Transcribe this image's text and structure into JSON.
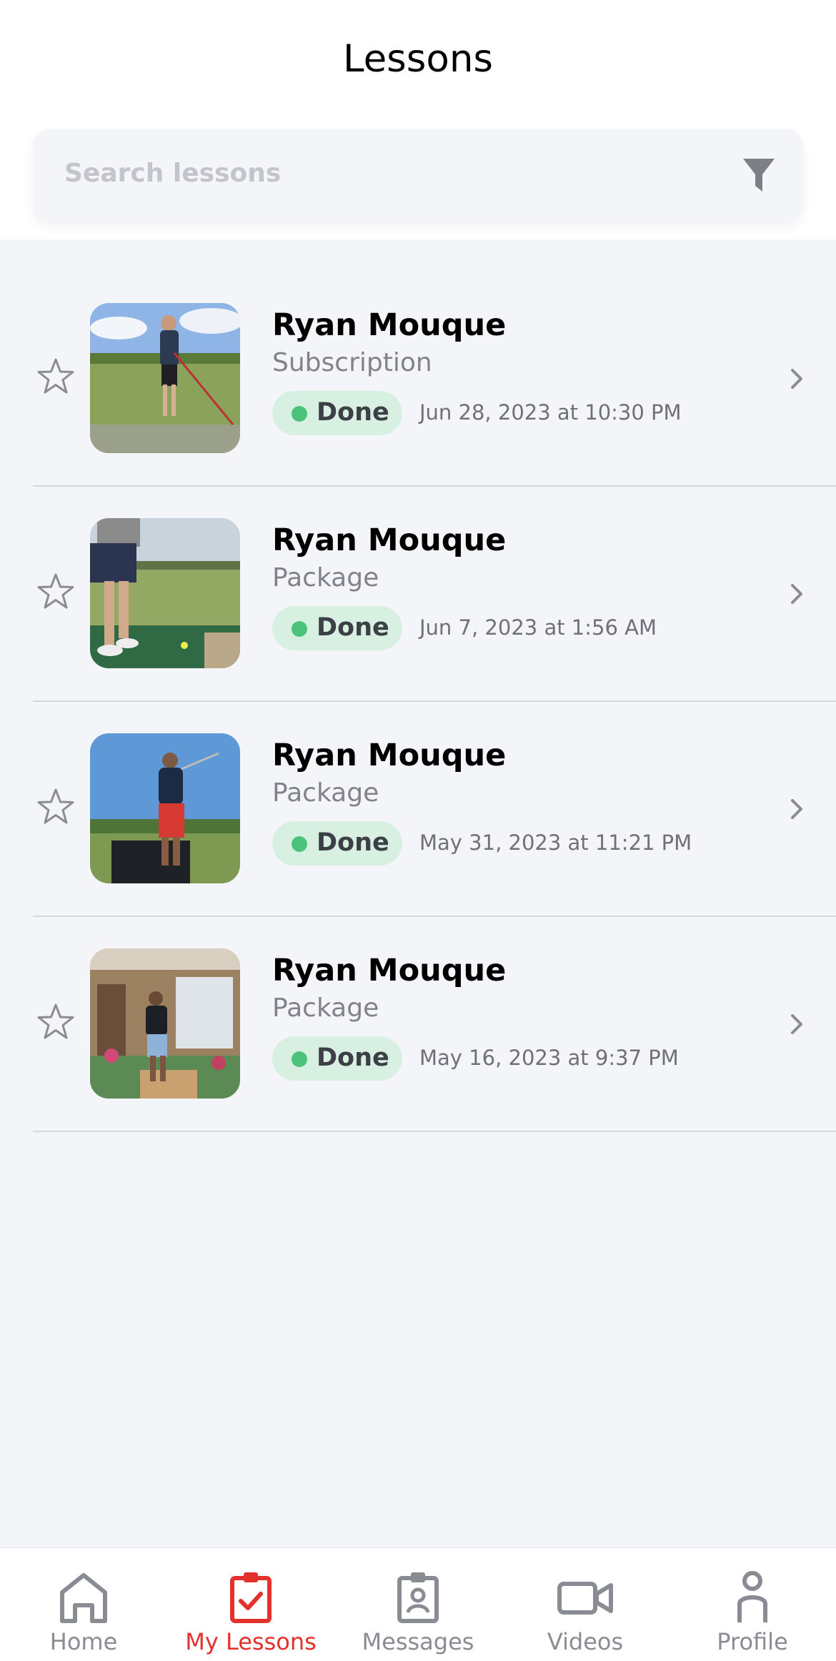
{
  "header": {
    "title": "Lessons"
  },
  "search": {
    "placeholder": "Search lessons",
    "filter_icon": "filter-icon"
  },
  "lessons": [
    {
      "coach": "Ryan Mouque",
      "type": "Subscription",
      "status": "Done",
      "date": "Jun 28, 2023 at 10:30 PM",
      "favorite": false
    },
    {
      "coach": "Ryan Mouque",
      "type": "Package",
      "status": "Done",
      "date": "Jun 7, 2023 at 1:56 AM",
      "favorite": false
    },
    {
      "coach": "Ryan Mouque",
      "type": "Package",
      "status": "Done",
      "date": "May 31, 2023 at 11:21 PM",
      "favorite": false
    },
    {
      "coach": "Ryan Mouque",
      "type": "Package",
      "status": "Done",
      "date": "May 16, 2023 at 9:37 PM",
      "favorite": false
    }
  ],
  "nav": {
    "items": [
      {
        "label": "Home",
        "icon": "home-icon",
        "active": false
      },
      {
        "label": "My Lessons",
        "icon": "clipboard-check-icon",
        "active": true
      },
      {
        "label": "Messages",
        "icon": "contact-badge-icon",
        "active": false
      },
      {
        "label": "Videos",
        "icon": "video-camera-icon",
        "active": false
      },
      {
        "label": "Profile",
        "icon": "person-icon",
        "active": false
      }
    ]
  },
  "colors": {
    "accent": "#e3312d",
    "status_done_bg": "#d8f0e2",
    "status_done_dot": "#4bc37b",
    "nav_inactive": "#8a8c93",
    "background": "#f4f5f9"
  }
}
